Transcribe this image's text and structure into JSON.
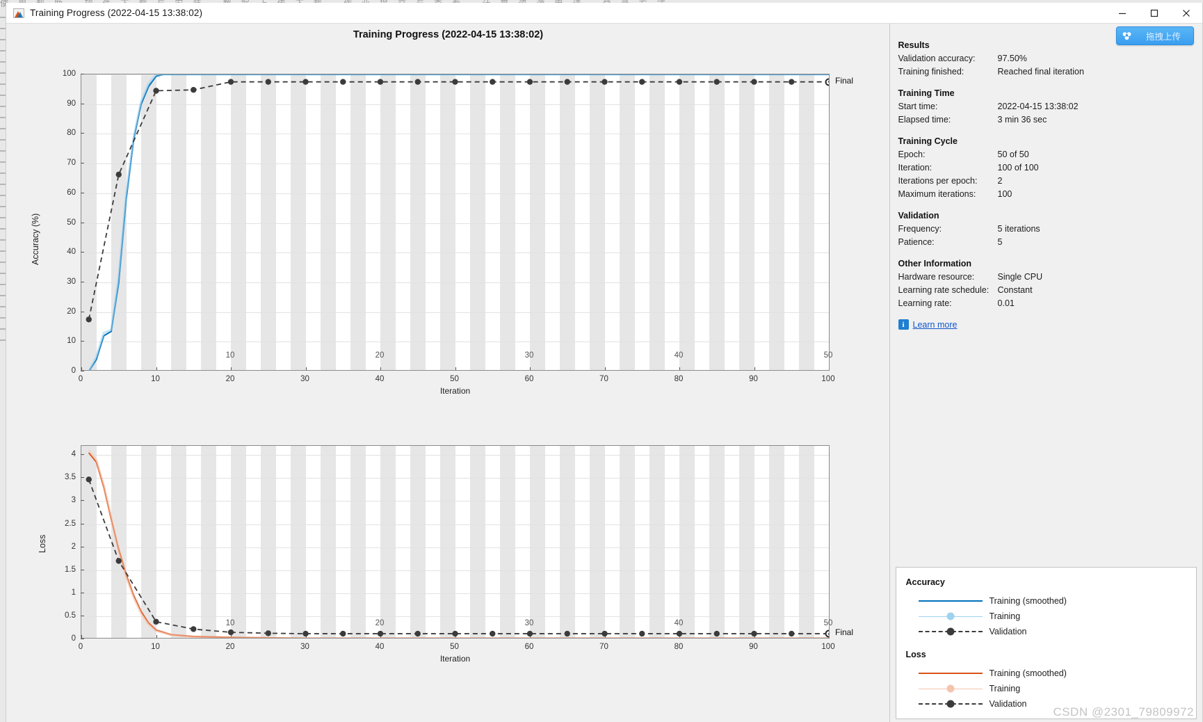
{
  "window": {
    "title": "Training Progress (2022-04-15 13:38:02)",
    "icon": "matlab-icon",
    "minimize_label": "–",
    "maximize_label": "□",
    "close_label": "×"
  },
  "desktop": {
    "strip_text": "使用帮助   软件下载与安装   数据上传下载   作业提交与查看   计算资源申请   登录方式"
  },
  "upload_button": {
    "label": "拖拽上传",
    "icon": "baidu-netdisk-icon"
  },
  "main": {
    "title": "Training Progress (2022-04-15 13:38:02)"
  },
  "info": {
    "sections": [
      {
        "heading": "Results",
        "rows": [
          {
            "key": "Validation accuracy:",
            "value": "97.50%"
          },
          {
            "key": "Training finished:",
            "value": "Reached final iteration"
          }
        ]
      },
      {
        "heading": "Training Time",
        "rows": [
          {
            "key": "Start time:",
            "value": "2022-04-15 13:38:02"
          },
          {
            "key": "Elapsed time:",
            "value": "3 min 36 sec"
          }
        ]
      },
      {
        "heading": "Training Cycle",
        "rows": [
          {
            "key": "Epoch:",
            "value": "50 of 50"
          },
          {
            "key": "Iteration:",
            "value": "100 of 100"
          },
          {
            "key": "Iterations per epoch:",
            "value": "2"
          },
          {
            "key": "Maximum iterations:",
            "value": "100"
          }
        ]
      },
      {
        "heading": "Validation",
        "rows": [
          {
            "key": "Frequency:",
            "value": "5 iterations"
          },
          {
            "key": "Patience:",
            "value": "5"
          }
        ]
      },
      {
        "heading": "Other Information",
        "rows": [
          {
            "key": "Hardware resource:",
            "value": "Single CPU"
          },
          {
            "key": "Learning rate schedule:",
            "value": "Constant"
          },
          {
            "key": "Learning rate:",
            "value": "0.01"
          }
        ]
      }
    ],
    "learn_more": {
      "label": "Learn more",
      "icon": "info-icon"
    }
  },
  "legend": {
    "groups": [
      {
        "heading": "Accuracy",
        "entries": [
          {
            "label": "Training (smoothed)",
            "style": "solid",
            "color": "#0072bd"
          },
          {
            "label": "Training",
            "style": "thin-marker",
            "color": "#9fd2ee"
          },
          {
            "label": "Validation",
            "style": "dashed-marker",
            "color": "#3b3b3b"
          }
        ]
      },
      {
        "heading": "Loss",
        "entries": [
          {
            "label": "Training (smoothed)",
            "style": "solid",
            "color": "#d95319"
          },
          {
            "label": "Training",
            "style": "thin-marker",
            "color": "#f5c4ad"
          },
          {
            "label": "Validation",
            "style": "dashed-marker",
            "color": "#3b3b3b"
          }
        ]
      }
    ]
  },
  "watermark": "CSDN @2301_79809972",
  "chart_data": [
    {
      "id": "accuracy",
      "type": "line",
      "title": "Accuracy",
      "xlabel": "Iteration",
      "ylabel": "Accuracy (%)",
      "xlim": [
        0,
        100
      ],
      "ylim": [
        0,
        100
      ],
      "xticks": [
        0,
        10,
        20,
        30,
        40,
        50,
        60,
        70,
        80,
        90,
        100
      ],
      "yticks": [
        0,
        10,
        20,
        30,
        40,
        50,
        60,
        70,
        80,
        90,
        100
      ],
      "epoch_ticks": [
        10,
        20,
        30,
        40,
        50
      ],
      "epoch_tick_iterations": [
        20,
        40,
        60,
        80,
        100
      ],
      "grid": true,
      "final_marker": {
        "x": 100,
        "y": 97.5,
        "label": "Final"
      },
      "series": [
        {
          "name": "Training (smoothed)",
          "color": "#0072bd",
          "style": "solid",
          "x": [
            1,
            2,
            3,
            4,
            5,
            6,
            7,
            8,
            9,
            10,
            11,
            12,
            15,
            20,
            30,
            40,
            50,
            60,
            70,
            80,
            90,
            100
          ],
          "y": [
            0,
            4,
            12,
            13.5,
            30,
            58,
            78,
            90,
            96,
            99.4,
            100,
            100,
            100,
            100,
            100,
            100,
            100,
            100,
            100,
            100,
            100,
            100
          ]
        },
        {
          "name": "Training",
          "color": "#9fd2ee",
          "style": "thin",
          "x": [
            1,
            2,
            3,
            4,
            5,
            6,
            7,
            8,
            9,
            10,
            11,
            12,
            15,
            20,
            30,
            40,
            50,
            60,
            70,
            80,
            90,
            100
          ],
          "y": [
            0,
            5,
            13,
            14,
            32,
            60,
            79,
            91,
            97,
            100,
            100,
            100,
            100,
            100,
            100,
            100,
            100,
            100,
            100,
            100,
            100,
            100
          ]
        },
        {
          "name": "Validation",
          "color": "#3b3b3b",
          "style": "dashed-marker",
          "x": [
            1,
            5,
            10,
            15,
            20,
            25,
            30,
            35,
            40,
            45,
            50,
            55,
            60,
            65,
            70,
            75,
            80,
            85,
            90,
            95,
            100
          ],
          "y": [
            17.5,
            66.3,
            94.5,
            94.8,
            97.5,
            97.5,
            97.5,
            97.5,
            97.5,
            97.5,
            97.5,
            97.5,
            97.5,
            97.5,
            97.5,
            97.5,
            97.5,
            97.5,
            97.5,
            97.5,
            97.5
          ]
        }
      ]
    },
    {
      "id": "loss",
      "type": "line",
      "title": "Loss",
      "xlabel": "Iteration",
      "ylabel": "Loss",
      "xlim": [
        0,
        100
      ],
      "ylim": [
        0,
        4.2
      ],
      "xticks": [
        0,
        10,
        20,
        30,
        40,
        50,
        60,
        70,
        80,
        90,
        100
      ],
      "yticks": [
        0,
        0.5,
        1,
        1.5,
        2,
        2.5,
        3,
        3.5,
        4
      ],
      "epoch_ticks": [
        10,
        20,
        30,
        40,
        50
      ],
      "epoch_tick_iterations": [
        20,
        40,
        60,
        80,
        100
      ],
      "grid": true,
      "final_marker": {
        "x": 100,
        "y": 0.12,
        "label": "Final"
      },
      "series": [
        {
          "name": "Training (smoothed)",
          "color": "#d95319",
          "style": "solid",
          "x": [
            1,
            2,
            3,
            4,
            5,
            6,
            7,
            8,
            9,
            10,
            12,
            15,
            20,
            30,
            40,
            50,
            60,
            70,
            80,
            90,
            100
          ],
          "y": [
            4.05,
            3.85,
            3.3,
            2.6,
            1.95,
            1.4,
            0.95,
            0.6,
            0.35,
            0.2,
            0.1,
            0.06,
            0.04,
            0.02,
            0.02,
            0.02,
            0.02,
            0.02,
            0.02,
            0.02,
            0.02
          ]
        },
        {
          "name": "Training",
          "color": "#f5c4ad",
          "style": "thin",
          "x": [
            1,
            2,
            3,
            4,
            5,
            6,
            7,
            8,
            9,
            10,
            12,
            15,
            20,
            30,
            40,
            50,
            60,
            70,
            80,
            90,
            100
          ],
          "y": [
            4.1,
            3.9,
            3.35,
            2.65,
            1.9,
            1.35,
            0.9,
            0.55,
            0.32,
            0.18,
            0.09,
            0.05,
            0.03,
            0.02,
            0.02,
            0.02,
            0.02,
            0.02,
            0.02,
            0.02,
            0.02
          ]
        },
        {
          "name": "Validation",
          "color": "#3b3b3b",
          "style": "dashed-marker",
          "x": [
            1,
            5,
            10,
            15,
            20,
            25,
            30,
            35,
            40,
            45,
            50,
            55,
            60,
            65,
            70,
            75,
            80,
            85,
            90,
            95,
            100
          ],
          "y": [
            3.47,
            1.7,
            0.38,
            0.22,
            0.15,
            0.13,
            0.12,
            0.12,
            0.12,
            0.12,
            0.12,
            0.12,
            0.12,
            0.12,
            0.12,
            0.12,
            0.12,
            0.12,
            0.12,
            0.12,
            0.12
          ]
        }
      ]
    }
  ]
}
